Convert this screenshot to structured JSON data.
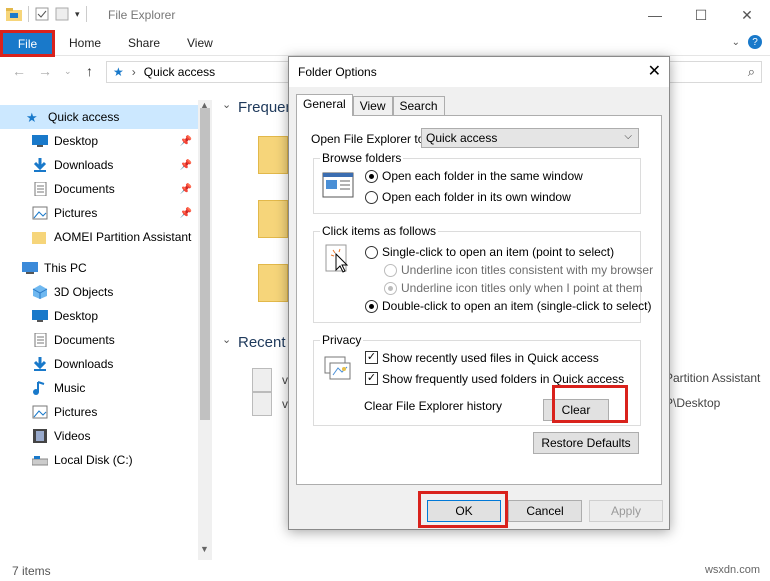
{
  "window": {
    "title": "File Explorer",
    "controls": [
      "—",
      "☐",
      "✕"
    ]
  },
  "ribbon": {
    "tabs": [
      "File",
      "Home",
      "Share",
      "View"
    ]
  },
  "address": {
    "path": "Quick access"
  },
  "navpane": {
    "quick_access": "Quick access",
    "items": [
      {
        "label": "Desktop",
        "icon": "desktop-icon",
        "pinned": true
      },
      {
        "label": "Downloads",
        "icon": "download-arrow-icon",
        "pinned": true
      },
      {
        "label": "Documents",
        "icon": "documents-icon",
        "pinned": true
      },
      {
        "label": "Pictures",
        "icon": "pictures-icon",
        "pinned": true
      },
      {
        "label": "AOMEI Partition Assistant",
        "icon": "folder-icon",
        "pinned": false
      }
    ],
    "this_pc": "This PC",
    "pc_items": [
      {
        "label": "3D Objects",
        "icon": "cube-icon"
      },
      {
        "label": "Desktop",
        "icon": "desktop-icon"
      },
      {
        "label": "Documents",
        "icon": "documents-icon"
      },
      {
        "label": "Downloads",
        "icon": "download-arrow-icon"
      },
      {
        "label": "Music",
        "icon": "music-note-icon"
      },
      {
        "label": "Pictures",
        "icon": "pictures-icon"
      },
      {
        "label": "Videos",
        "icon": "film-icon"
      },
      {
        "label": "Local Disk (C:)",
        "icon": "drive-icon"
      }
    ]
  },
  "content": {
    "frequent_heading": "Frequen",
    "recent_heading": "Recent",
    "recent_items": [
      {
        "left": "v",
        "right": "Partition Assistant"
      },
      {
        "left": "v",
        "right": "P\\Desktop"
      }
    ]
  },
  "status": {
    "items_count": "7 items",
    "watermark": "wsxdn.com"
  },
  "dialog": {
    "title": "Folder Options",
    "tabs": [
      "General",
      "View",
      "Search"
    ],
    "open_label": "Open File Explorer to:",
    "open_value": "Quick access",
    "browse": {
      "title": "Browse folders",
      "opt1": "Open each folder in the same window",
      "opt2": "Open each folder in its own window"
    },
    "click": {
      "title": "Click items as follows",
      "single": "Single-click to open an item (point to select)",
      "underline1": "Underline icon titles consistent with my browser",
      "underline2": "Underline icon titles only when I point at them",
      "double": "Double-click to open an item (single-click to select)"
    },
    "privacy": {
      "title": "Privacy",
      "check1": "Show recently used files in Quick access",
      "check2": "Show frequently used folders in Quick access",
      "clear_label": "Clear File Explorer history",
      "clear_button": "Clear"
    },
    "restore_button": "Restore Defaults",
    "ok_button": "OK",
    "cancel_button": "Cancel",
    "apply_button": "Apply"
  },
  "colors": {
    "accent": "#1979ca",
    "highlight": "#d9221c",
    "selected": "#cce8ff"
  }
}
